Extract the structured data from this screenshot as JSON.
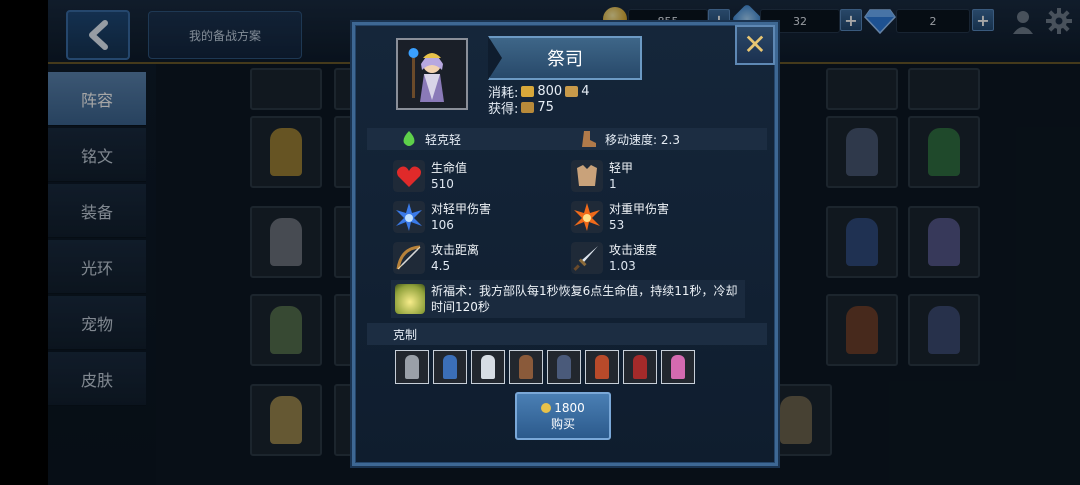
{
  "topbar": {
    "plan_label": "我的备战方案",
    "gold_value": "855",
    "crystal_value": "32",
    "diamond_value": "2",
    "plus_symbol": "+"
  },
  "sidebar": {
    "items": [
      {
        "label": "阵容",
        "active": true
      },
      {
        "label": "铭文",
        "active": false
      },
      {
        "label": "装备",
        "active": false
      },
      {
        "label": "光环",
        "active": false
      },
      {
        "label": "宠物",
        "active": false
      },
      {
        "label": "皮肤",
        "active": false
      }
    ]
  },
  "modal": {
    "title": "祭司",
    "close_symbol": "✕",
    "cost_label": "消耗:",
    "cost_gold": "800",
    "cost_pop": "4",
    "gain_label": "获得:",
    "gain_value": "75",
    "armor_class": "轻克轻",
    "move_speed": "移动速度: 2.3",
    "stats": [
      {
        "label": "生命值",
        "value": "510",
        "icon": "heart-icon",
        "color": "#e02a2a"
      },
      {
        "label": "轻甲",
        "value": "1",
        "icon": "light-armor-icon",
        "color": "#c9a27a"
      },
      {
        "label": "对轻甲伤害",
        "value": "106",
        "icon": "blue-burst-icon",
        "color": "#3a7ae8"
      },
      {
        "label": "对重甲伤害",
        "value": "53",
        "icon": "fire-burst-icon",
        "color": "#f06a1a"
      },
      {
        "label": "攻击距离",
        "value": "4.5",
        "icon": "bow-icon",
        "color": "#b8823a"
      },
      {
        "label": "攻击速度",
        "value": "1.03",
        "icon": "dagger-icon",
        "color": "#c8d4e2"
      }
    ],
    "skill_text": "祈福术：我方部队每1秒恢复6点生命值，持续11秒，冷却时间120秒",
    "counter_label": "克制",
    "counters": [
      {
        "icon": "eagle-unit-icon",
        "color": "#9aa0a8"
      },
      {
        "icon": "blue-archer-unit-icon",
        "color": "#3b6fb8"
      },
      {
        "icon": "white-rogue-unit-icon",
        "color": "#d7dde4"
      },
      {
        "icon": "bandit-unit-icon",
        "color": "#8a5a3a"
      },
      {
        "icon": "mage-unit-icon",
        "color": "#4a5a7a"
      },
      {
        "icon": "monk-unit-icon",
        "color": "#b84a2a"
      },
      {
        "icon": "red-warrior-unit-icon",
        "color": "#a42a2a"
      },
      {
        "icon": "pink-witch-unit-icon",
        "color": "#d46ab0"
      }
    ],
    "buy_price": "1800",
    "buy_label": "购买"
  }
}
